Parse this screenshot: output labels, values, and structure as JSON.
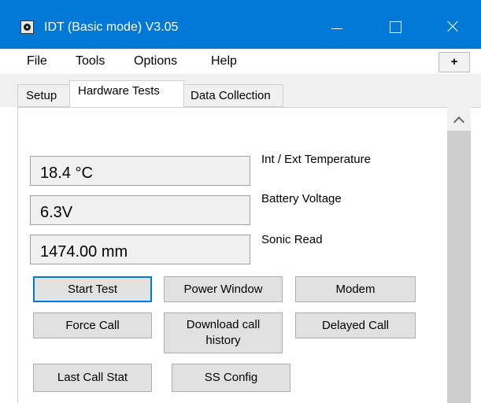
{
  "window": {
    "title": "IDT (Basic mode) V3.05",
    "icons": {
      "app": "app-icon",
      "minimize": "minimize-icon",
      "maximize": "maximize-icon",
      "close": "close-icon"
    },
    "accent": "#0078d7"
  },
  "menu": {
    "items": [
      "File",
      "Tools",
      "Options",
      "Help"
    ],
    "plus_label": "+"
  },
  "tabs": {
    "items": [
      "Setup",
      "Hardware Tests",
      "Data Collection"
    ],
    "active": "Hardware Tests"
  },
  "readings": {
    "temperature": {
      "value": "18.4 °C",
      "label": "Int / Ext Temperature"
    },
    "battery": {
      "value": "6.3V",
      "label": "Battery Voltage"
    },
    "sonic": {
      "value": "1474.00 mm",
      "label": "Sonic Read"
    }
  },
  "buttons": {
    "start_test": "Start Test",
    "power_window": "Power Window",
    "modem": "Modem",
    "force_call": "Force Call",
    "download_history": "Download call history",
    "delayed_call": "Delayed Call",
    "last_call_stat": "Last Call Stat",
    "ss_config": "SS Config"
  }
}
